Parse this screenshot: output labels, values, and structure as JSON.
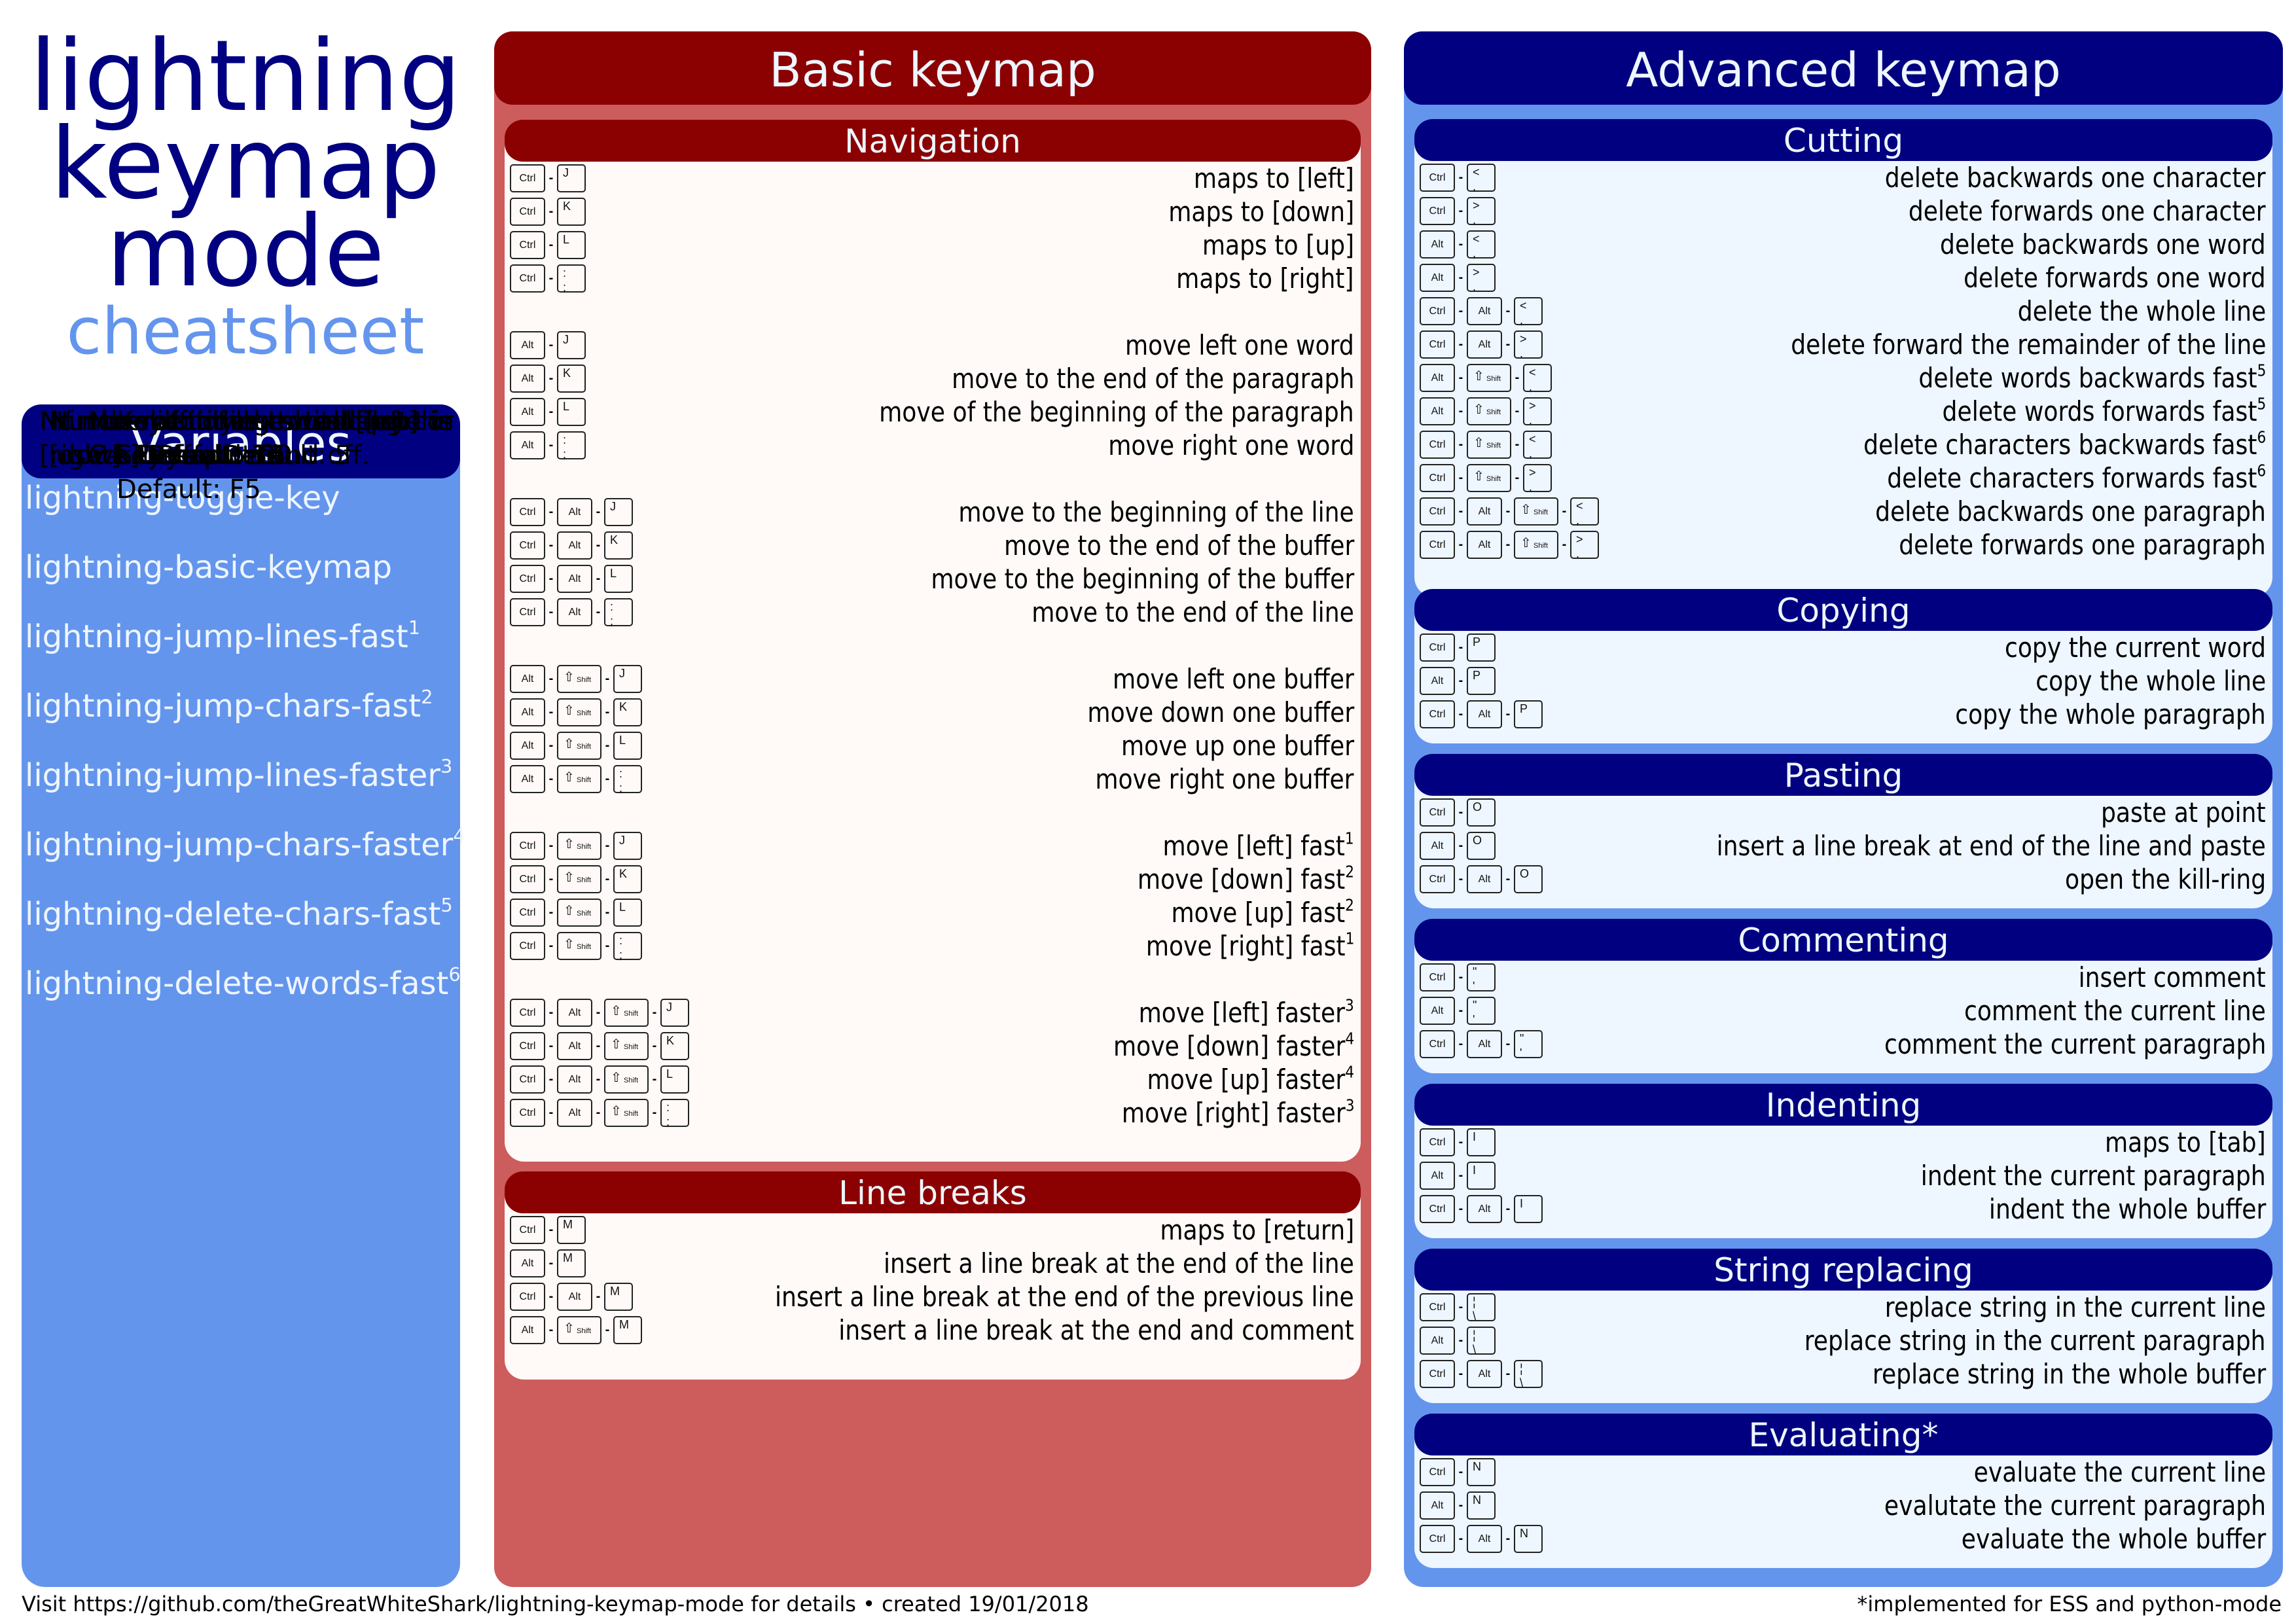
{
  "title": {
    "lines": [
      "lightning",
      "keymap",
      "mode"
    ],
    "subtitle": "cheatsheet"
  },
  "colors": {
    "navy": "#000080",
    "cornflower": "#6495ed",
    "darkred": "#8b0000",
    "indianred": "#cd5c5c",
    "panel_light_blue": "#eef6ff",
    "panel_light_red": "#fffaf8"
  },
  "variables": {
    "header": "Variables",
    "items": [
      {
        "name": "lightning-toggle-key",
        "sup": "",
        "desc": "Key binding switching the\nkeymap on and off.\nDefault: F5"
      },
      {
        "name": "lightning-basic-keymap",
        "sup": "",
        "desc": "If non-nil only the basic part is\nused. Default: nil"
      },
      {
        "name": "lightning-jump-lines-fast",
        "sup": "1",
        "desc": "Number of times to call [up] or\n[down]. Default: 4"
      },
      {
        "name": "lightning-jump-chars-fast",
        "sup": "2",
        "desc": "Number of times to call [left] or\n[right]. Default: 3"
      },
      {
        "name": "lightning-jump-lines-faster",
        "sup": "3",
        "desc": "Number of times to call [up] or\n[down. Default: 30"
      },
      {
        "name": "lightning-jump-chars-faster",
        "sup": "4",
        "desc": "Number of times to call [left] or\n[right]. Default: 15"
      },
      {
        "name": "lightning-delete-chars-fast",
        "sup": "5",
        "desc": "Number of lines to delete in\nC-S-layer. Default: 5"
      },
      {
        "name": "lightning-delete-words-fast",
        "sup": "6",
        "desc": "Number of lines to delete in\nC-S-layer. Default: 5"
      }
    ]
  },
  "basic": {
    "header": "Basic keymap",
    "sections": [
      {
        "title": "Navigation",
        "rows": [
          {
            "keys": [
              "Ctrl",
              "J"
            ],
            "desc": "maps to [left]",
            "sup": ""
          },
          {
            "keys": [
              "Ctrl",
              "K"
            ],
            "desc": "maps to [down]",
            "sup": ""
          },
          {
            "keys": [
              "Ctrl",
              "L"
            ],
            "desc": "maps to [up]",
            "sup": ""
          },
          {
            "keys": [
              "Ctrl",
              ":\n;"
            ],
            "desc": "maps to [right]",
            "sup": ""
          },
          {
            "gap": true
          },
          {
            "keys": [
              "Alt",
              "J"
            ],
            "desc": "move left one word",
            "sup": ""
          },
          {
            "keys": [
              "Alt",
              "K"
            ],
            "desc": "move to the end of the paragraph",
            "sup": ""
          },
          {
            "keys": [
              "Alt",
              "L"
            ],
            "desc": "move of the beginning of the paragraph",
            "sup": ""
          },
          {
            "keys": [
              "Alt",
              ":\n;"
            ],
            "desc": "move right one word",
            "sup": ""
          },
          {
            "gap": true
          },
          {
            "keys": [
              "Ctrl",
              "Alt",
              "J"
            ],
            "desc": "move to the beginning of the line",
            "sup": ""
          },
          {
            "keys": [
              "Ctrl",
              "Alt",
              "K"
            ],
            "desc": "move to the end of the buffer",
            "sup": ""
          },
          {
            "keys": [
              "Ctrl",
              "Alt",
              "L"
            ],
            "desc": "move to the beginning of the buffer",
            "sup": ""
          },
          {
            "keys": [
              "Ctrl",
              "Alt",
              ":\n;"
            ],
            "desc": "move to the end of the line",
            "sup": ""
          },
          {
            "gap": true
          },
          {
            "keys": [
              "Alt",
              "Shift",
              "J"
            ],
            "desc": "move left one buffer",
            "sup": ""
          },
          {
            "keys": [
              "Alt",
              "Shift",
              "K"
            ],
            "desc": "move down one buffer",
            "sup": ""
          },
          {
            "keys": [
              "Alt",
              "Shift",
              "L"
            ],
            "desc": "move up one buffer",
            "sup": ""
          },
          {
            "keys": [
              "Alt",
              "Shift",
              ":\n;"
            ],
            "desc": "move right one buffer",
            "sup": ""
          },
          {
            "gap": true
          },
          {
            "keys": [
              "Ctrl",
              "Shift",
              "J"
            ],
            "desc": "move [left] fast",
            "sup": "1"
          },
          {
            "keys": [
              "Ctrl",
              "Shift",
              "K"
            ],
            "desc": "move [down] fast",
            "sup": "2"
          },
          {
            "keys": [
              "Ctrl",
              "Shift",
              "L"
            ],
            "desc": "move [up] fast",
            "sup": "2"
          },
          {
            "keys": [
              "Ctrl",
              "Shift",
              ":\n;"
            ],
            "desc": "move [right] fast",
            "sup": "1"
          },
          {
            "gap": true
          },
          {
            "keys": [
              "Ctrl",
              "Alt",
              "Shift",
              "J"
            ],
            "desc": "move [left] faster",
            "sup": "3"
          },
          {
            "keys": [
              "Ctrl",
              "Alt",
              "Shift",
              "K"
            ],
            "desc": "move [down] faster",
            "sup": "4"
          },
          {
            "keys": [
              "Ctrl",
              "Alt",
              "Shift",
              "L"
            ],
            "desc": "move [up] faster",
            "sup": "4"
          },
          {
            "keys": [
              "Ctrl",
              "Alt",
              "Shift",
              ":\n;"
            ],
            "desc": "move [right] faster",
            "sup": "3"
          }
        ]
      },
      {
        "title": "Line breaks",
        "rows": [
          {
            "keys": [
              "Ctrl",
              "M"
            ],
            "desc": "maps to [return]",
            "sup": ""
          },
          {
            "keys": [
              "Alt",
              "M"
            ],
            "desc": "insert a line break at the end of the line",
            "sup": ""
          },
          {
            "keys": [
              "Ctrl",
              "Alt",
              "M"
            ],
            "desc": "insert a line break at the end of the previous line",
            "sup": ""
          },
          {
            "keys": [
              "Alt",
              "Shift",
              "M"
            ],
            "desc": "insert a line break at the end and comment",
            "sup": ""
          }
        ]
      }
    ]
  },
  "advanced": {
    "header": "Advanced keymap",
    "sections": [
      {
        "title": "Cutting",
        "rows": [
          {
            "keys": [
              "Ctrl",
              "<\n,"
            ],
            "desc": "delete backwards one character",
            "sup": ""
          },
          {
            "keys": [
              "Ctrl",
              ">\n."
            ],
            "desc": "delete forwards one character",
            "sup": ""
          },
          {
            "keys": [
              "Alt",
              "<\n,"
            ],
            "desc": "delete backwards one word",
            "sup": ""
          },
          {
            "keys": [
              "Alt",
              ">\n."
            ],
            "desc": "delete forwards one word",
            "sup": ""
          },
          {
            "keys": [
              "Ctrl",
              "Alt",
              "<\n,"
            ],
            "desc": "delete the whole line",
            "sup": ""
          },
          {
            "keys": [
              "Ctrl",
              "Alt",
              ">\n."
            ],
            "desc": "delete forward the remainder of the line",
            "sup": ""
          },
          {
            "keys": [
              "Alt",
              "Shift",
              "<\n,"
            ],
            "desc": "delete words backwards fast",
            "sup": "5"
          },
          {
            "keys": [
              "Alt",
              "Shift",
              ">\n."
            ],
            "desc": "delete words forwards fast",
            "sup": "5"
          },
          {
            "keys": [
              "Ctrl",
              "Shift",
              "<\n,"
            ],
            "desc": "delete characters backwards fast",
            "sup": "6"
          },
          {
            "keys": [
              "Ctrl",
              "Shift",
              ">\n."
            ],
            "desc": "delete characters forwards fast",
            "sup": "6"
          },
          {
            "keys": [
              "Ctrl",
              "Alt",
              "Shift",
              "<\n,"
            ],
            "desc": "delete backwards one paragraph",
            "sup": ""
          },
          {
            "keys": [
              "Ctrl",
              "Alt",
              "Shift",
              ">\n."
            ],
            "desc": "delete forwards one paragraph",
            "sup": ""
          }
        ]
      },
      {
        "title": "Copying",
        "rows": [
          {
            "keys": [
              "Ctrl",
              "P"
            ],
            "desc": "copy the current word",
            "sup": ""
          },
          {
            "keys": [
              "Alt",
              "P"
            ],
            "desc": "copy the whole line",
            "sup": ""
          },
          {
            "keys": [
              "Ctrl",
              "Alt",
              "P"
            ],
            "desc": "copy the whole paragraph",
            "sup": ""
          }
        ]
      },
      {
        "title": "Pasting",
        "rows": [
          {
            "keys": [
              "Ctrl",
              "O"
            ],
            "desc": "paste at point",
            "sup": ""
          },
          {
            "keys": [
              "Alt",
              "O"
            ],
            "desc": "insert a line break at end of the line and paste",
            "sup": ""
          },
          {
            "keys": [
              "Ctrl",
              "Alt",
              "O"
            ],
            "desc": "open the kill-ring",
            "sup": ""
          }
        ]
      },
      {
        "title": "Commenting",
        "rows": [
          {
            "keys": [
              "Ctrl",
              "\"\n'"
            ],
            "desc": "insert comment",
            "sup": ""
          },
          {
            "keys": [
              "Alt",
              "\"\n'"
            ],
            "desc": "comment the current line",
            "sup": ""
          },
          {
            "keys": [
              "Ctrl",
              "Alt",
              "\"\n'"
            ],
            "desc": "comment the current paragraph",
            "sup": ""
          }
        ]
      },
      {
        "title": "Indenting",
        "rows": [
          {
            "keys": [
              "Ctrl",
              "I"
            ],
            "desc": "maps to [tab]",
            "sup": ""
          },
          {
            "keys": [
              "Alt",
              "I"
            ],
            "desc": "indent the current paragraph",
            "sup": ""
          },
          {
            "keys": [
              "Ctrl",
              "Alt",
              "I"
            ],
            "desc": "indent the whole buffer",
            "sup": ""
          }
        ]
      },
      {
        "title": "String replacing",
        "rows": [
          {
            "keys": [
              "Ctrl",
              "¦\n\\"
            ],
            "desc": "replace string in the current line",
            "sup": ""
          },
          {
            "keys": [
              "Alt",
              "¦\n\\"
            ],
            "desc": "replace string in the current paragraph",
            "sup": ""
          },
          {
            "keys": [
              "Ctrl",
              "Alt",
              "¦\n\\"
            ],
            "desc": "replace string in the whole buffer",
            "sup": ""
          }
        ]
      },
      {
        "title": "Evaluating*",
        "rows": [
          {
            "keys": [
              "Ctrl",
              "N"
            ],
            "desc": "evaluate the current line",
            "sup": ""
          },
          {
            "keys": [
              "Alt",
              "N"
            ],
            "desc": "evalutate the current paragraph",
            "sup": ""
          },
          {
            "keys": [
              "Ctrl",
              "Alt",
              "N"
            ],
            "desc": "evaluate the whole buffer",
            "sup": ""
          }
        ]
      }
    ]
  },
  "footer": {
    "left": "Visit https://github.com/theGreatWhiteShark/lightning-keymap-mode for details  •  created 19/01/2018",
    "right": "*implemented for ESS and python-mode"
  },
  "icons": {
    "shift": "shift-arrow-icon"
  },
  "shift_label": "Shift",
  "shift_glyph": "⇧"
}
